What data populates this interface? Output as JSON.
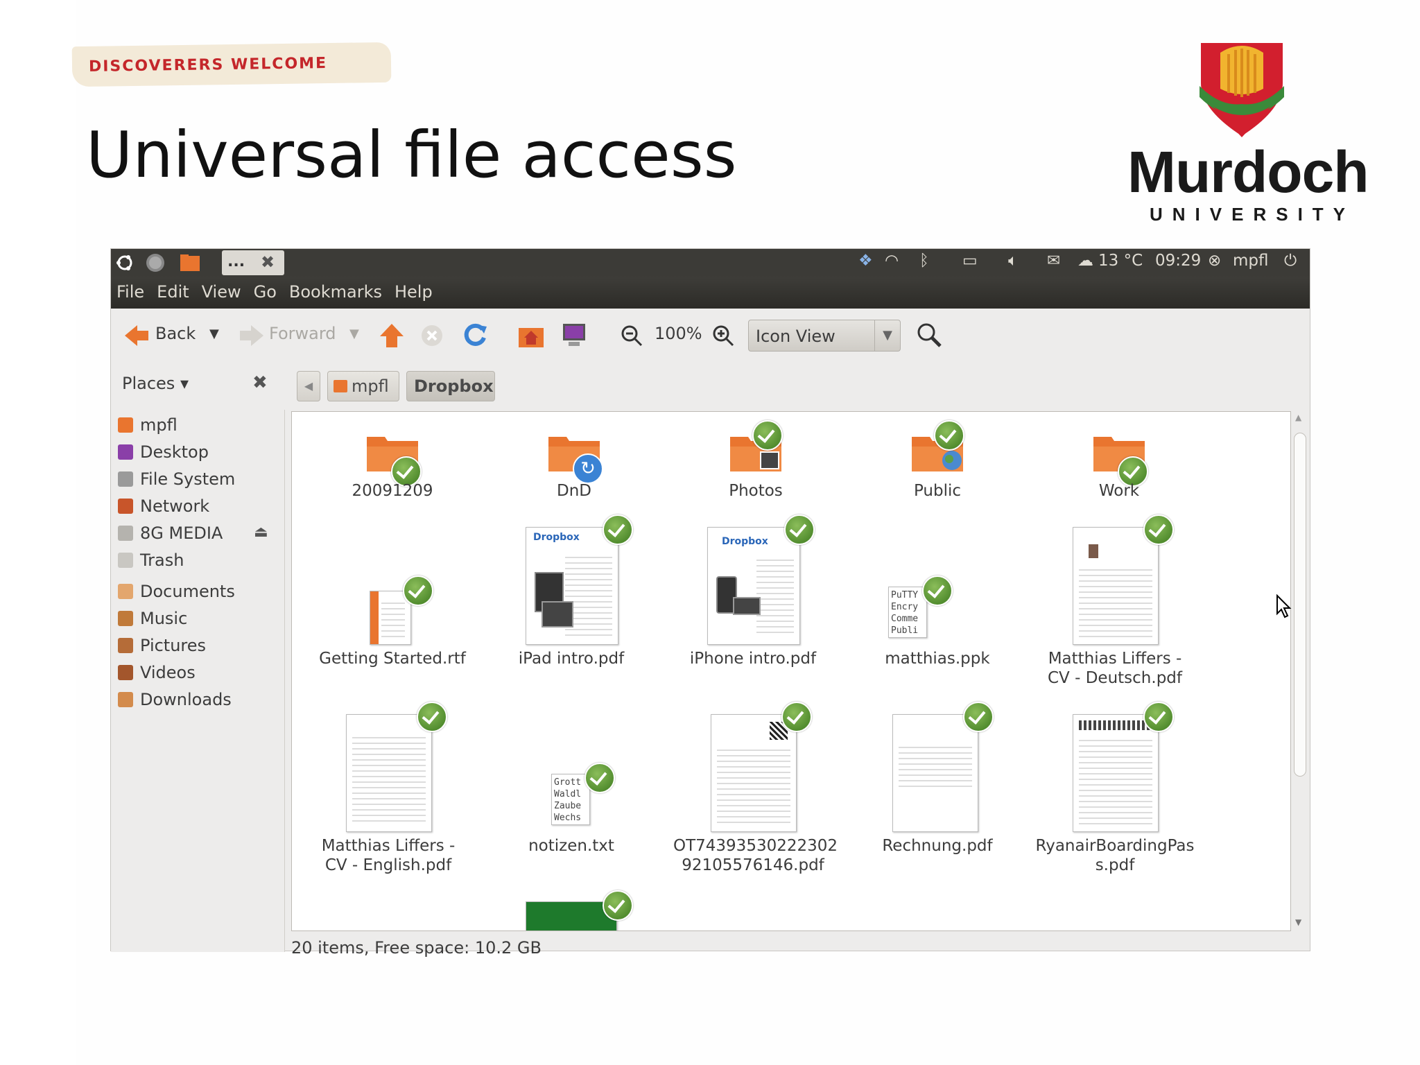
{
  "slide": {
    "banner": "DISCOVERERS WELCOME",
    "title": "Universal file access",
    "logo": {
      "name": "Murdoch",
      "sub": "UNIVERSITY"
    }
  },
  "topbar": {
    "tab_label": "...",
    "temperature": "13 °C",
    "time": "09:29",
    "user": "mpfl"
  },
  "menu": [
    "File",
    "Edit",
    "View",
    "Go",
    "Bookmarks",
    "Help"
  ],
  "toolbar": {
    "back": "Back",
    "forward": "Forward",
    "zoom": "100%",
    "view_mode": "Icon View"
  },
  "sidebar": {
    "header": "Places",
    "items": [
      "mpfl",
      "Desktop",
      "File System",
      "Network",
      "8G MEDIA",
      "Trash"
    ],
    "bookmarks": [
      "Documents",
      "Music",
      "Pictures",
      "Videos",
      "Downloads"
    ]
  },
  "pathbar": {
    "parent": "mpfl",
    "current": "Dropbox"
  },
  "files": [
    {
      "name": "20091209",
      "kind": "folder",
      "icon": "folder-sync-ok"
    },
    {
      "name": "DnD",
      "kind": "folder",
      "icon": "folder-syncing"
    },
    {
      "name": "Photos",
      "kind": "folder",
      "icon": "folder-photos"
    },
    {
      "name": "Public",
      "kind": "folder",
      "icon": "folder-public"
    },
    {
      "name": "Work",
      "kind": "folder",
      "icon": "folder-sync-ok"
    },
    {
      "name": "Getting Started.rtf",
      "kind": "document"
    },
    {
      "name": "iPad intro.pdf",
      "kind": "pdf"
    },
    {
      "name": "iPhone intro.pdf",
      "kind": "pdf"
    },
    {
      "name": "matthias.ppk",
      "kind": "text",
      "preview": "PuTTY\nEncry\nComme\nPubli"
    },
    {
      "name": "Matthias Liffers - CV - Deutsch.pdf",
      "kind": "pdf"
    },
    {
      "name": "Matthias Liffers - CV - English.pdf",
      "kind": "pdf"
    },
    {
      "name": "notizen.txt",
      "kind": "text",
      "preview": "Grott\nWaldl\nZaube\nWechs"
    },
    {
      "name": "OT74393530222302 92105576146.pdf",
      "kind": "pdf"
    },
    {
      "name": "Rechnung.pdf",
      "kind": "pdf"
    },
    {
      "name": "RyanairBoardingPass.pdf",
      "kind": "pdf"
    }
  ],
  "file_labels": {
    "f0": "20091209",
    "f1": "DnD",
    "f2": "Photos",
    "f3": "Public",
    "f4": "Work",
    "f5": "Getting Started.rtf",
    "f6": "iPad intro.pdf",
    "f7": "iPhone intro.pdf",
    "f8": "matthias.ppk",
    "f9a": "Matthias Liffers -",
    "f9b": "CV - Deutsch.pdf",
    "f10a": "Matthias Liffers -",
    "f10b": "CV - English.pdf",
    "f11": "notizen.txt",
    "f12a": "OT74393530222302",
    "f12b": "92105576146.pdf",
    "f13": "Rechnung.pdf",
    "f14a": "RyanairBoardingPas",
    "f14b": "s.pdf"
  },
  "thumb_text": {
    "dropbox": "Dropbox",
    "ppk": [
      "PuTTY",
      "Encry",
      "Comme",
      "Publi"
    ],
    "txt": [
      "Grott",
      "Waldl",
      "Zaube",
      "Wechs"
    ]
  },
  "status": "20 items, Free space: 10.2 GB",
  "colors": {
    "accent": "#e9752f",
    "topbar": "#3c3b37",
    "sync_ok": "#4a8a2a"
  }
}
